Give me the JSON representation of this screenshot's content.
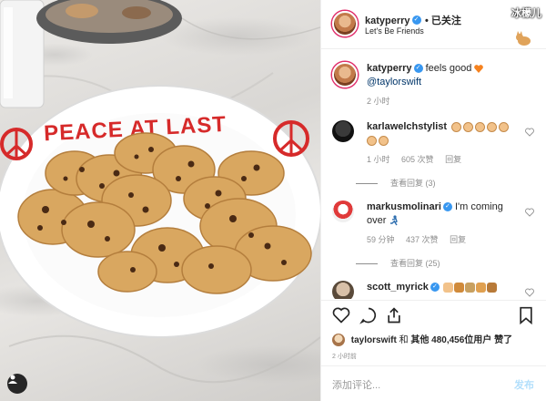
{
  "post": {
    "author": "katyperry",
    "follow_label": "• 已关注",
    "location": "Let's Be Friends",
    "plate_text": "PEACE AT LAST"
  },
  "caption": {
    "author": "katyperry",
    "text": "feels good",
    "mention": "@taylorswift",
    "time": "2 小时"
  },
  "comments": [
    {
      "author": "karlawelchstylist",
      "time": "1 小时",
      "likes": "605 次赞",
      "reply_label": "回复",
      "view_replies": "查看回复 (3)"
    },
    {
      "author": "markusmolinari",
      "text": "I'm coming over",
      "time": "59 分钟",
      "likes": "437 次赞",
      "reply_label": "回复",
      "view_replies": "查看回复 (25)"
    },
    {
      "author": "scott_myrick"
    }
  ],
  "likes": {
    "user": "taylorswift",
    "connector": "和",
    "others_label": "其他",
    "count": "480,456",
    "suffix": "位用户 赞了"
  },
  "post_time": "2 小时前",
  "composer": {
    "placeholder": "添加评论...",
    "post_label": "发布"
  },
  "watermark": "冰檬儿",
  "colors": {
    "verified": "#3897f0",
    "heart": "#ed4956",
    "frosting": "#d62a2a",
    "link": "#003569"
  }
}
